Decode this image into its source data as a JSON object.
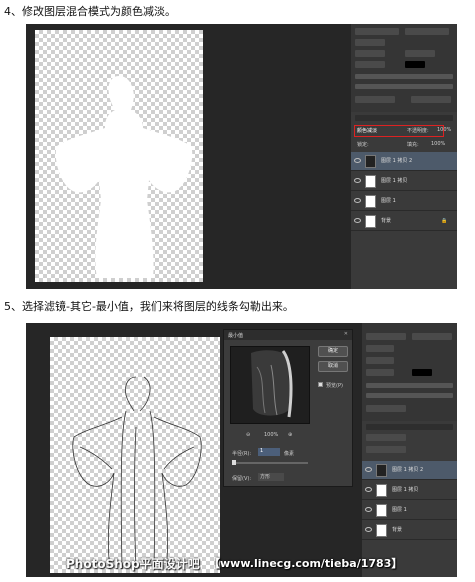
{
  "step4": {
    "text": "4、修改图层混合模式为颜色减淡。"
  },
  "step5": {
    "text": "5、选择滤镜-其它-最小值，我们来将图层的线条勾勒出来。"
  },
  "shot1": {
    "layers_panel": {
      "blend_mode": "颜色减淡",
      "opacity_label": "不透明度:",
      "opacity_value": "100%",
      "fill_label": "填充:",
      "fill_value": "100%",
      "lock_label": "锁定:",
      "layers": [
        {
          "name": "图层 1 拷贝 2"
        },
        {
          "name": "图层 1 拷贝"
        },
        {
          "name": "图层 1"
        },
        {
          "name": "背景"
        }
      ]
    }
  },
  "shot2": {
    "dialog": {
      "title": "最小值",
      "ok_label": "确定",
      "cancel_label": "取消",
      "preview_label": "预览(P)",
      "zoom_value": "100%",
      "radius_label": "半径(R):",
      "radius_value": "1",
      "radius_unit": "像素",
      "preserve_label": "保留(V):",
      "preserve_value": "方形"
    },
    "layers_panel": {
      "layers": [
        {
          "name": "图层 1 拷贝 2"
        },
        {
          "name": "图层 1 拷贝"
        },
        {
          "name": "图层 1"
        },
        {
          "name": "背景"
        }
      ]
    },
    "watermark": {
      "brand": "PhotoShop平面设计吧",
      "url": "【www.linecg.com/tieba/1783】"
    }
  },
  "colors": {
    "workspace": "#262626",
    "panel": "#353535",
    "highlight": "#d22222"
  },
  "icons": [
    "eye-icon",
    "zoom-in-icon",
    "zoom-out-icon",
    "lock-icon"
  ]
}
